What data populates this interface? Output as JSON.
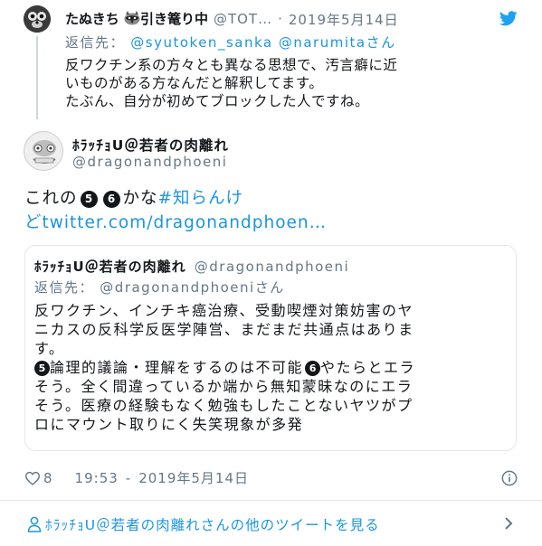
{
  "reply_tweet": {
    "display_name": "たぬきち",
    "name_icon": "raccoon-emoji",
    "name_suffix": "引き篭り中",
    "handle": "@TOT…",
    "separator": "·",
    "date": "2019年5月14日",
    "reply_prefix": "返信先：",
    "reply_to_1": "@syutoken_sanka",
    "reply_to_2": "@narumitaさん",
    "text_line_1": "反ワクチン系の方々とも異なる思想で、汚言癖に近",
    "text_line_2": "いものがある方なんだと解釈してます。",
    "text_line_3": "たぶん、自分が初めてブロックした人ですね。"
  },
  "main_tweet": {
    "display_name": "ﾎﾗｯﾁｮU＠若者の肉離れ",
    "handle": "@dragonandphoeni",
    "text_prefix": "これの",
    "badge_a": "5",
    "badge_b": "6",
    "text_middle": "かな",
    "hashtag": "#知らんけ",
    "link": "どtwitter.com/dragonandphoen…"
  },
  "quoted_tweet": {
    "display_name": "ﾎﾗｯﾁｮU＠若者の肉離れ",
    "handle": "@dragonandphoeni",
    "reply_prefix": "返信先：",
    "reply_to": "@dragonandphoeni",
    "reply_suffix": "さん",
    "line_1": "反ワクチン、インチキ癌治療、受動喫煙対策妨害のヤ",
    "line_2": "ニカスの反科学反医学陣営、まだまだ共通点はありま",
    "line_3": "す。",
    "badge_a": "5",
    "line_4": "論理的議論・理解をするのは不可能",
    "badge_b": "6",
    "line_4b": "やたらとエラ",
    "line_5": "そう。全く間違っているか端から無知蒙昧なのにエラ",
    "line_6": "そう。医療の経験もなく勉強もしたことないヤツがプ",
    "line_7": "ロにマウント取りにく失笑現象が多発"
  },
  "meta": {
    "like_count": "8",
    "time": "19:53",
    "dash": "-",
    "date": "2019年5月14日"
  },
  "footer": {
    "more_tweets": "ﾎﾗｯﾁｮU＠若者の肉離れさんの他のツイートを見る"
  },
  "colors": {
    "twitter_blue": "#1da1f2",
    "link_blue": "#1b95e0",
    "text": "#14171a",
    "secondary": "#657786",
    "border": "#e1e8ed"
  },
  "icons": [
    "twitter-bird-icon",
    "heart-icon",
    "info-icon",
    "person-icon",
    "chevron-right-icon"
  ]
}
